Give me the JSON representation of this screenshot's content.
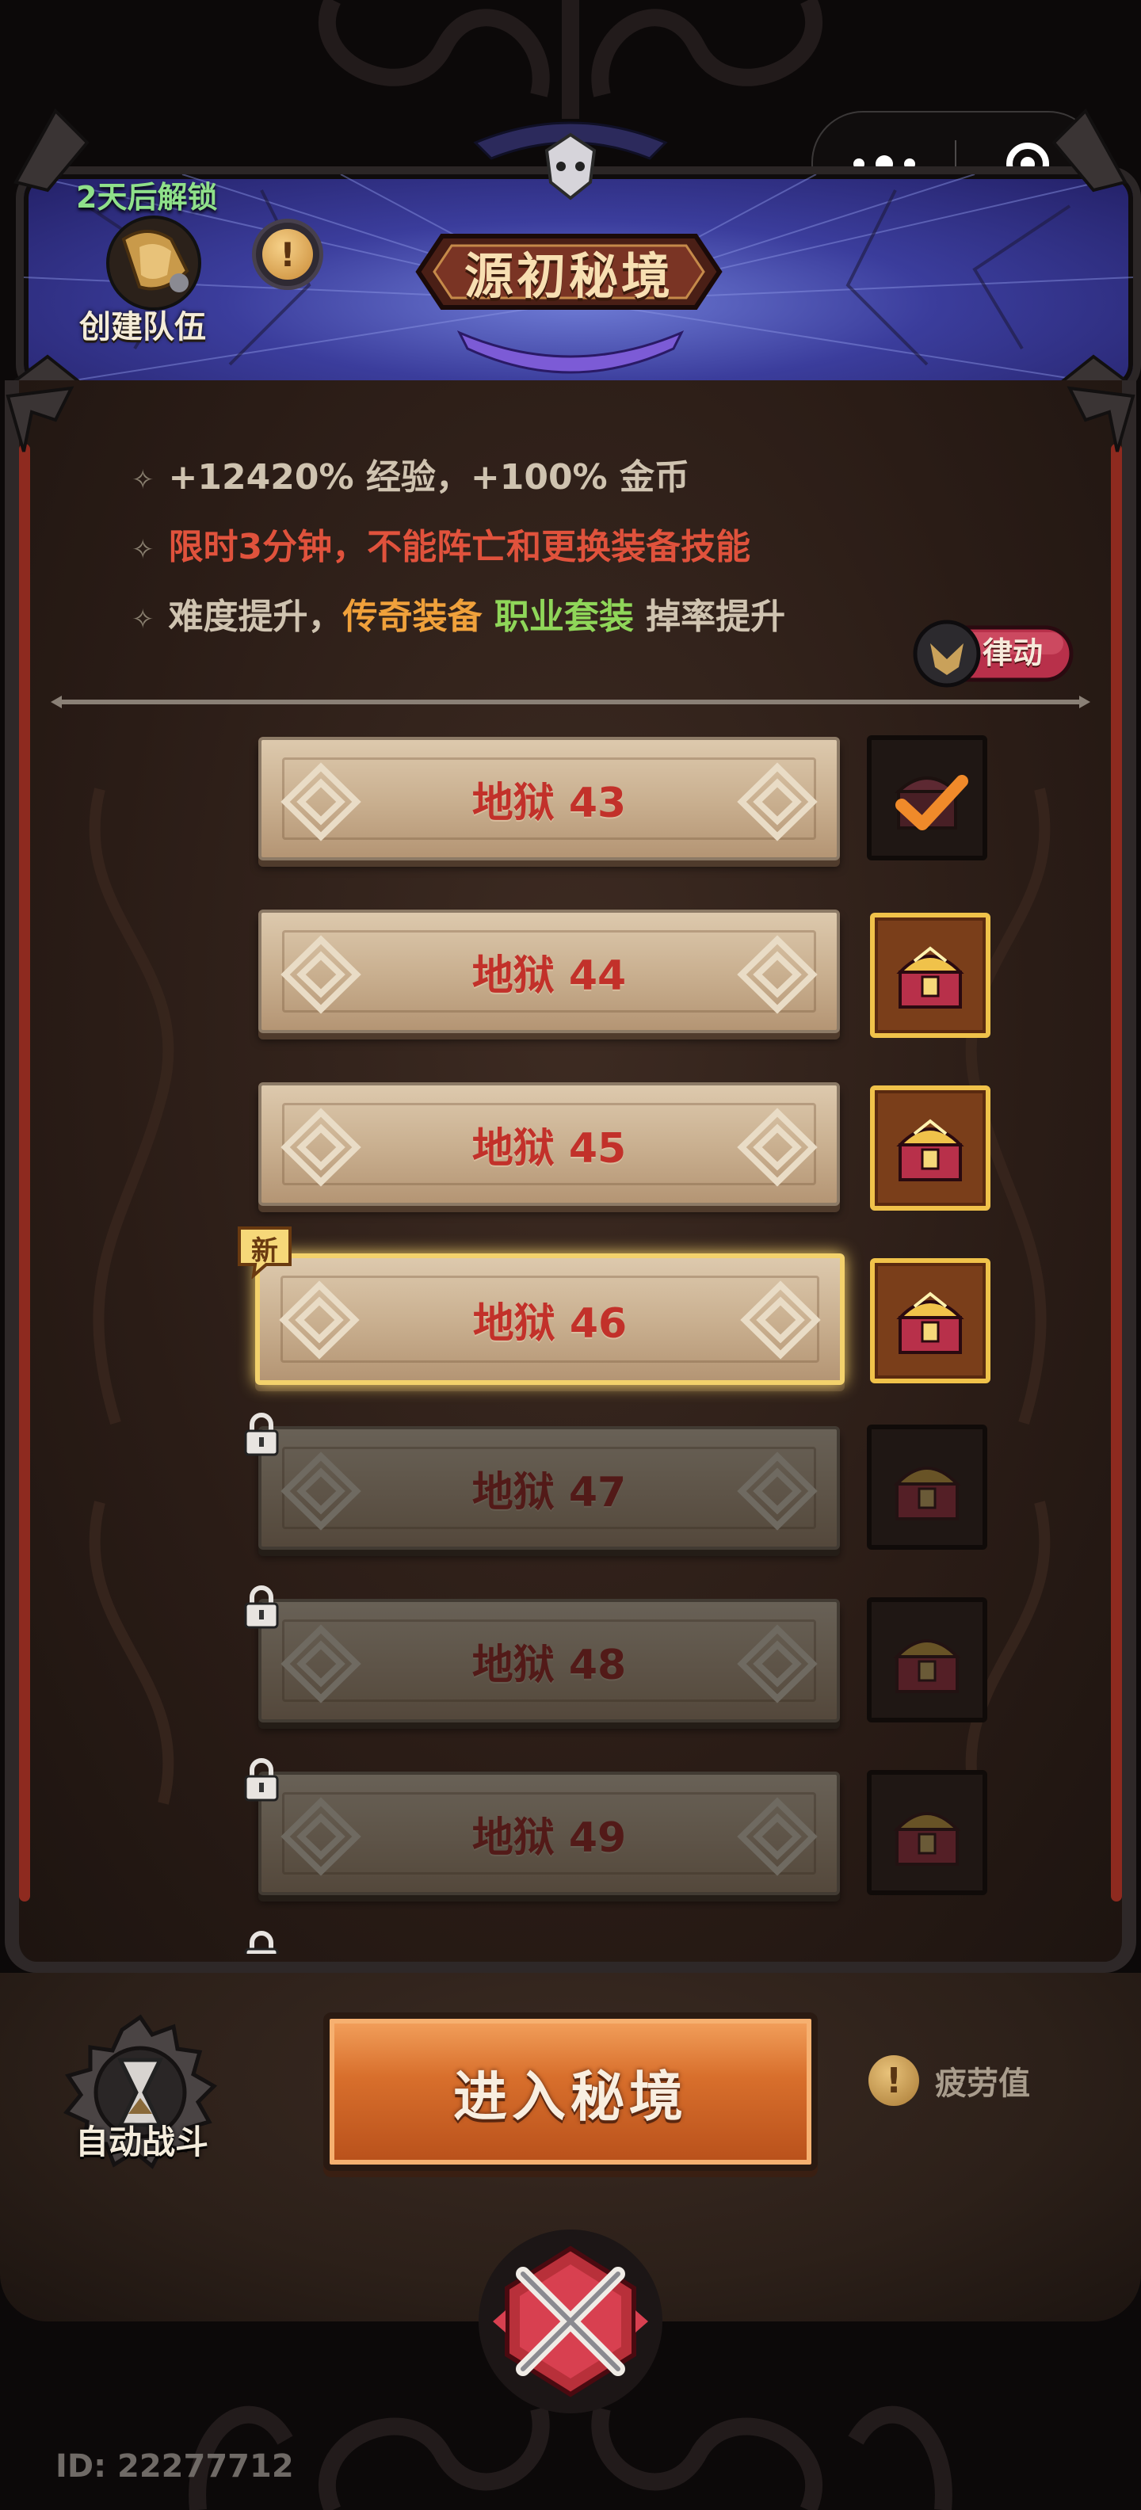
{
  "header": {
    "unlock_text": "2天后解锁",
    "team_label": "创建队伍",
    "title": "源初秘境",
    "info_icon": "exclamation-icon"
  },
  "capsule": {
    "more_icon": "more-dots-icon",
    "close_icon": "target-circle-icon"
  },
  "rules": {
    "r1": "+12420% 经验，+100% 金币",
    "r2": "限时3分钟，不能阵亡和更换装备技能",
    "r3_prefix": "难度提升，",
    "r3_legend": "传奇装备",
    "r3_set": "职业套装",
    "r3_suffix": "掉率提升"
  },
  "linked_badge": "律动",
  "levels": [
    {
      "label": "地狱 43",
      "state": "cleared",
      "chest": "claimed"
    },
    {
      "label": "地狱 44",
      "state": "cleared",
      "chest": "available"
    },
    {
      "label": "地狱 45",
      "state": "cleared",
      "chest": "available"
    },
    {
      "label": "地狱 46",
      "state": "current",
      "chest": "available",
      "new_tag": "新"
    },
    {
      "label": "地狱 47",
      "state": "locked",
      "chest": "locked"
    },
    {
      "label": "地狱 48",
      "state": "locked",
      "chest": "locked"
    },
    {
      "label": "地狱 49",
      "state": "locked",
      "chest": "locked"
    }
  ],
  "bottom": {
    "auto_battle": "自动战斗",
    "enter_button": "进入秘境",
    "fatigue_label": "疲劳值"
  },
  "player_id": "ID: 22277712",
  "colors": {
    "banner": "#3b3d9c",
    "level_text": "#c2312a",
    "highlight": "#f3d26c",
    "enter_button": "#d86f2c"
  }
}
